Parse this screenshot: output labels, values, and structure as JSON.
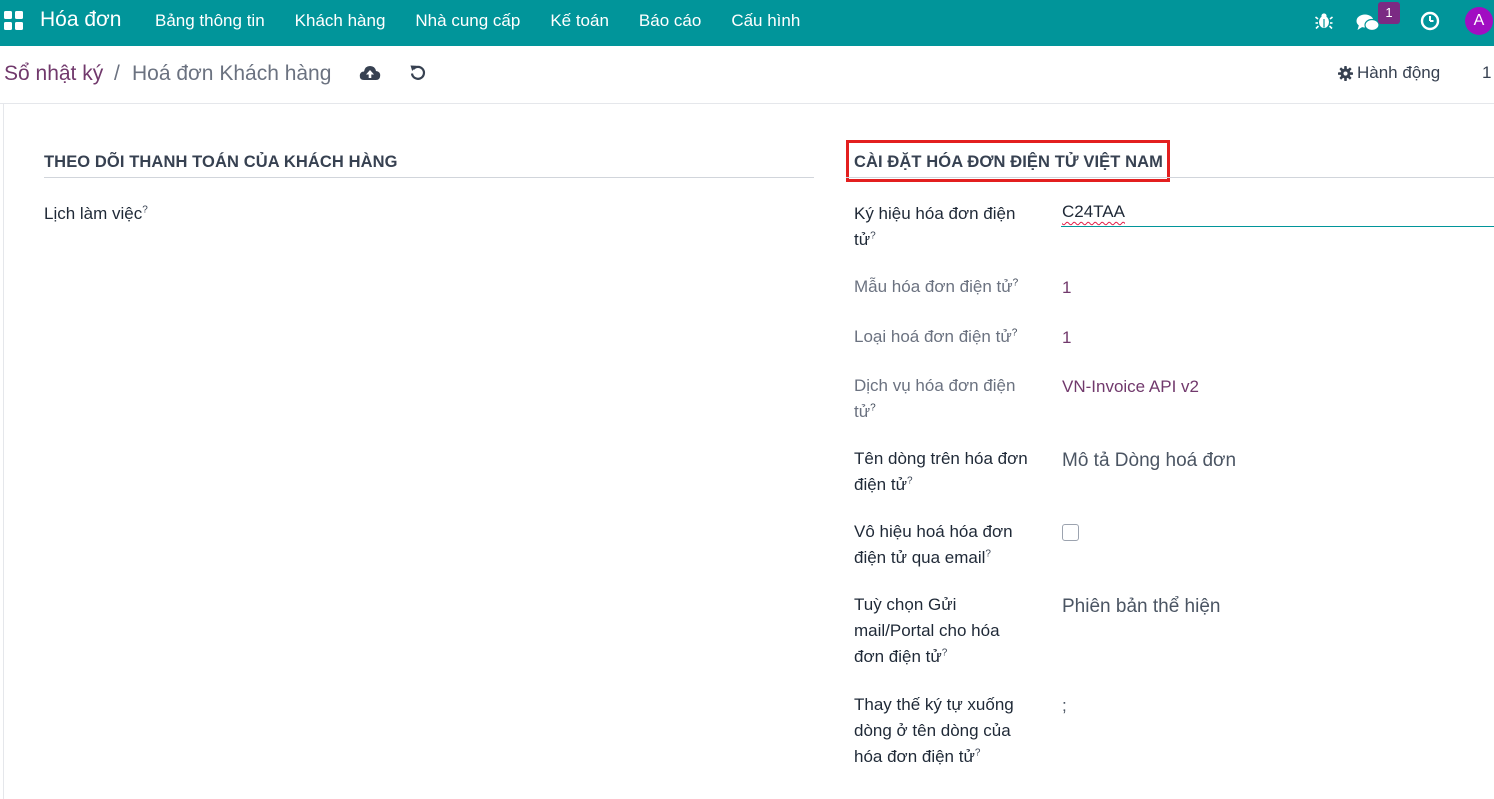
{
  "navbar": {
    "app_name": "Hóa đơn",
    "menu": [
      "Bảng thông tin",
      "Khách hàng",
      "Nhà cung cấp",
      "Kế toán",
      "Báo cáo",
      "Cấu hình"
    ],
    "messages_count": "1",
    "avatar_initial": "A",
    "icons": [
      "apps-grid-icon",
      "bug-icon",
      "chat-icon",
      "clock-icon"
    ],
    "bg_color": "#01959a",
    "avatar_color": "#a10dc2",
    "badge_color": "#7b2a83"
  },
  "control_panel": {
    "breadcrumb_root": "Sổ nhật ký",
    "separator": "/",
    "breadcrumb_current": "Hoá đơn Khách hàng",
    "action_label": "Hành động",
    "pager": "1",
    "icons": [
      "cloud-upload-icon",
      "undo-icon",
      "gear-icon"
    ]
  },
  "left_group": {
    "title": "THEO DÕI THANH TOÁN CỦA KHÁCH HÀNG",
    "work_schedule_label": "Lịch làm việc",
    "help_mark": "?"
  },
  "right_group": {
    "title": "CÀI ĐẶT HÓA ĐƠN ĐIỆN TỬ VIỆT NAM",
    "highlight_color": "#e31f1f",
    "fields": {
      "symbol": {
        "label_line1": "Ký hiệu hóa đơn điện",
        "label_line2": "tử",
        "value": "C24TAA"
      },
      "template": {
        "label": "Mẫu hóa đơn điện tử",
        "value": "1"
      },
      "type": {
        "label": "Loại hoá đơn điện tử",
        "value": "1"
      },
      "service": {
        "label_line1": "Dịch vụ hóa đơn điện",
        "label_line2": "tử",
        "value": "VN-Invoice API v2"
      },
      "line_name": {
        "label_line1": "Tên dòng trên hóa đơn",
        "label_line2": "điện tử",
        "value": "Mô tả Dòng hoá đơn"
      },
      "disable_email": {
        "label_line1": "Vô hiệu hoá hóa đơn",
        "label_line2": "điện tử qua email",
        "checked": false
      },
      "send_option": {
        "label_line1": "Tuỳ chọn Gửi",
        "label_line2": "mail/Portal cho hóa",
        "label_line3": "đơn điện tử",
        "value": "Phiên bản thể hiện"
      },
      "newline_replace": {
        "label_line1": "Thay thế ký tự xuống",
        "label_line2": "dòng ở tên dòng của",
        "label_line3": "hóa đơn điện tử",
        "value": ";"
      }
    },
    "help_mark": "?"
  }
}
